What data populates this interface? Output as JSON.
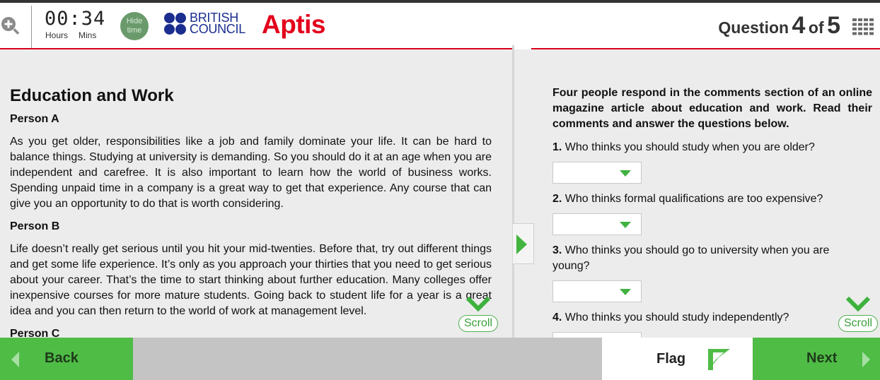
{
  "header": {
    "timer": "00:34",
    "timer_hours_label": "Hours",
    "timer_mins_label": "Mins",
    "hide_time_line1": "Hide",
    "hide_time_line2": "time",
    "brand_line1": "BRITISH",
    "brand_line2": "COUNCIL",
    "product": "Aptis",
    "question_word": "Question",
    "question_current": "4",
    "question_of": "of",
    "question_total": "5"
  },
  "passage": {
    "title": "Education and Work",
    "person_a": "Person A",
    "text_a": "As you get older, responsibilities like a job and family dominate your life. It can be hard to balance things. Studying at university is demanding. So you should do it at an age when you are independent and carefree. It is also important to learn how the world of business works. Spending unpaid time in a company is a great way to get that experience. Any course that can give you an opportunity to do that is worth considering.",
    "person_b": "Person B",
    "text_b": "Life doesn’t really get serious until you hit your mid-twenties. Before that, try out different things and get some life experience. It’s only as you approach your thirties that you need to get serious about your career. That’s the time to start thinking about further education. Many colleges offer inexpensive courses for more mature students. Going back to student life for a year is a great idea and you can then return to the world of work at management level.",
    "person_c": "Person C"
  },
  "questions": {
    "instructions": "Four people respond in the comments section of an online magazine article about education and work. Read their comments and answer the questions below.",
    "items": [
      {
        "num": "1.",
        "text": "Who thinks you should study when you are older?"
      },
      {
        "num": "2.",
        "text": "Who thinks formal qualifications are too expensive?"
      },
      {
        "num": "3.",
        "text": "Who thinks you should go to university when you are young?"
      },
      {
        "num": "4.",
        "text": "Who thinks you should study independently?"
      }
    ]
  },
  "scroll_label": "Scroll",
  "footer": {
    "back": "Back",
    "flag": "Flag",
    "next": "Next"
  },
  "colors": {
    "accent_green": "#4fbc46",
    "brand_red": "#e3001b",
    "brand_blue": "#1b2e8f"
  }
}
